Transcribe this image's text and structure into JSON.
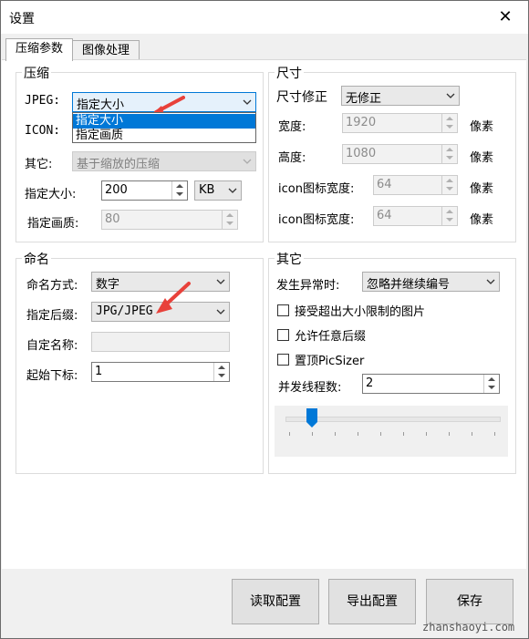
{
  "window": {
    "title": "设置"
  },
  "tabs": [
    "压缩参数",
    "图像处理"
  ],
  "compress": {
    "legend": "压缩",
    "jpeg_label": "JPEG:",
    "jpeg_value": "指定大小",
    "icon_label": "ICON:",
    "other_label": "其它:",
    "other_value": "基于缩放的压缩",
    "size_label": "指定大小:",
    "size_value": "200",
    "unit_value": "KB",
    "quality_label": "指定画质:",
    "quality_value": "80",
    "dropdown_options": [
      "指定大小",
      "指定画质"
    ]
  },
  "size": {
    "legend": "尺寸",
    "fix_label": "尺寸修正",
    "fix_value": "无修正",
    "width_label": "宽度:",
    "width_value": "1920",
    "height_label": "高度:",
    "height_value": "1080",
    "icon_w1_label": "icon图标宽度:",
    "icon_w1_value": "64",
    "icon_w2_label": "icon图标宽度:",
    "icon_w2_value": "64",
    "unit": "像素"
  },
  "naming": {
    "legend": "命名",
    "mode_label": "命名方式:",
    "mode_value": "数字",
    "suffix_label": "指定后缀:",
    "suffix_value": "JPG/JPEG",
    "custom_label": "自定名称:",
    "custom_value": "",
    "start_label": "起始下标:",
    "start_value": "1"
  },
  "other": {
    "legend": "其它",
    "error_label": "发生异常时:",
    "error_value": "忽略并继续编号",
    "check1": "接受超出大小限制的图片",
    "check2": "允许任意后缀",
    "check3": "置顶PicSizer",
    "threads_label": "并发线程数:",
    "threads_value": "2"
  },
  "buttons": {
    "read": "读取配置",
    "export": "导出配置",
    "save": "保存"
  },
  "watermark": "zhanshaoyi.com",
  "colors": {
    "selection": "#0078d7",
    "annotation_arrow": "#e8413a"
  },
  "icons": [
    "close-icon",
    "chevron-down-icon",
    "spinner-up-icon",
    "spinner-down-icon",
    "red-arrow-annotation"
  ]
}
